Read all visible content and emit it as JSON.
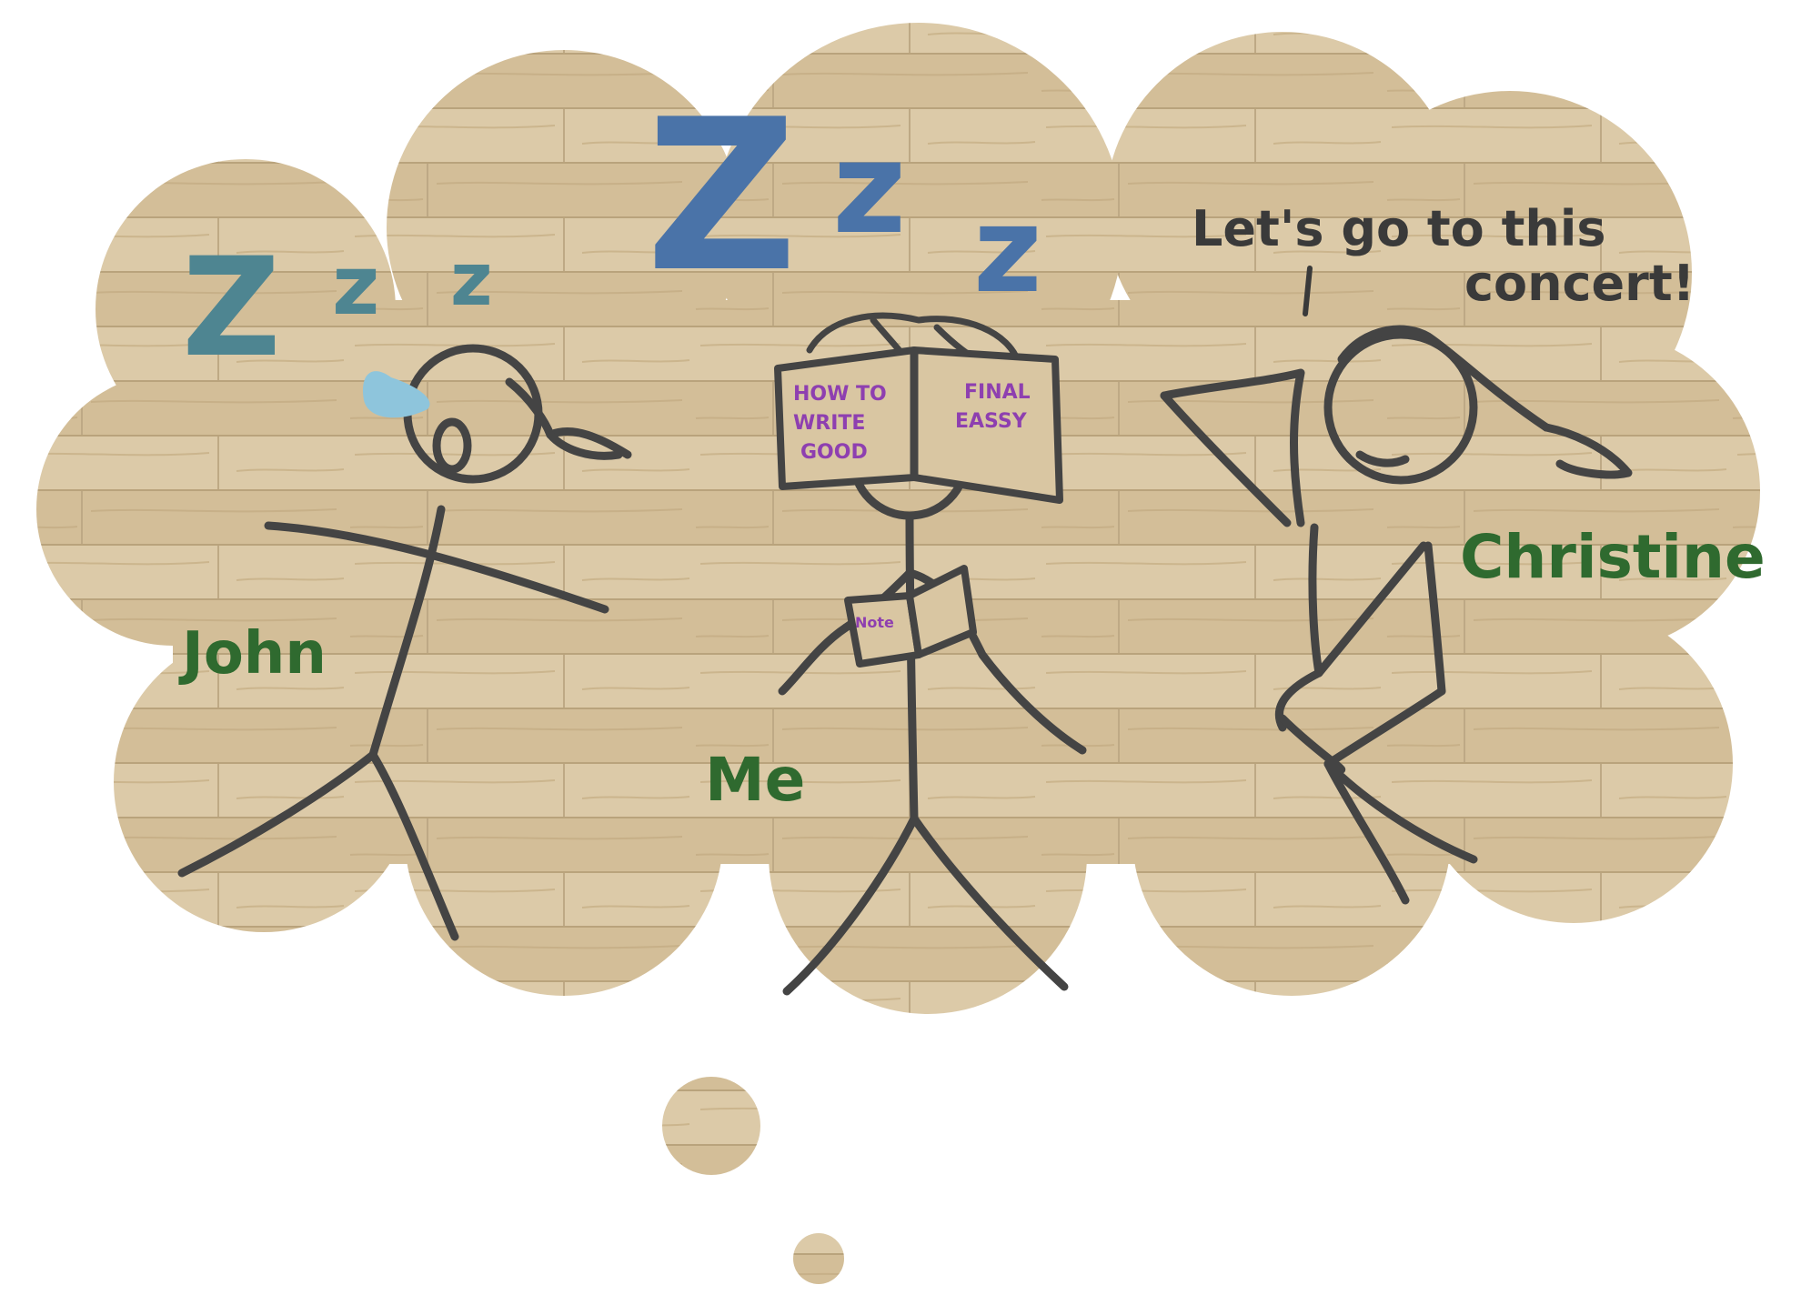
{
  "labels": {
    "john": "John",
    "me": "Me",
    "christine": "Christine",
    "speech_line1": "Let's go to this",
    "speech_line2": "concert!"
  },
  "book": {
    "left_page_line1": "HOW TO",
    "left_page_line2": "WRITE",
    "left_page_line3": "GOOD",
    "right_page_line1": "FINAL",
    "right_page_line2": "EASSY"
  },
  "notebook": {
    "label": "Note"
  },
  "snore": {
    "large": "Z",
    "medium": "z",
    "small": "z"
  },
  "colors": {
    "wood_light": "#dcc9a6",
    "wood_mid": "#cfb990",
    "wood_dark": "#c2ab80",
    "figure_stroke": "#444444",
    "label_green": "#2f6a2f",
    "text_purple": "#8e3fb0",
    "snore_teal": "#4e8591",
    "snore_blue": "#4a73a8",
    "sweat_blue": "#8ec5dc",
    "speech_text": "#3a3a3a"
  }
}
